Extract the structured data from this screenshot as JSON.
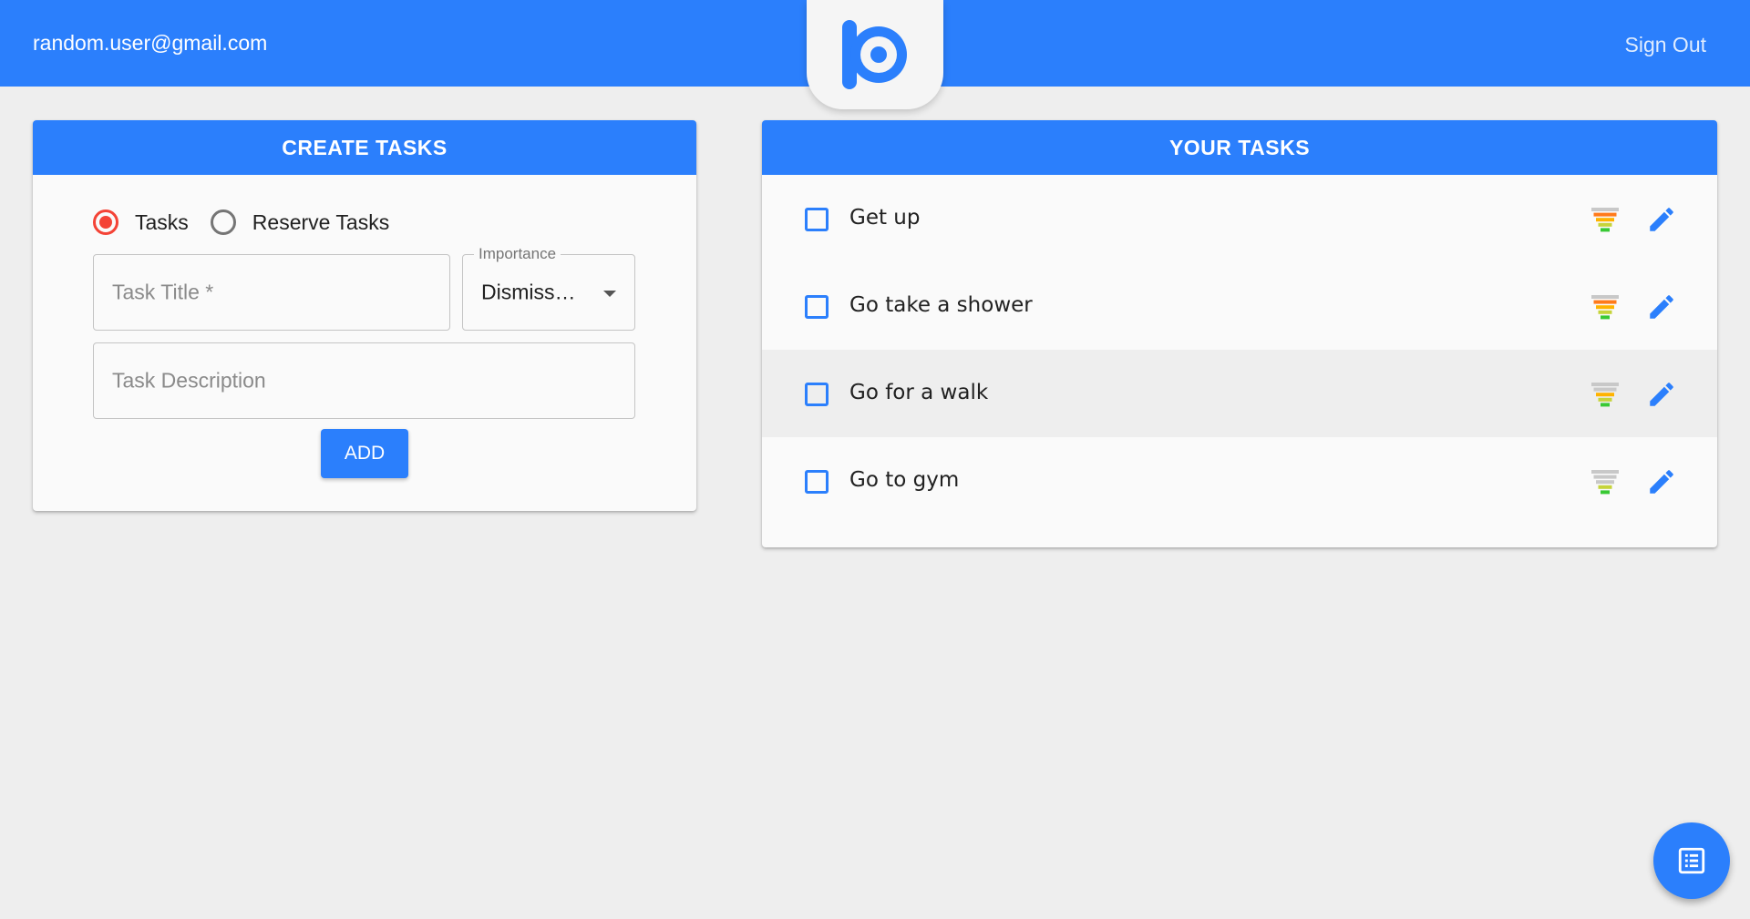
{
  "header": {
    "user_email": "random.user@gmail.com",
    "sign_out_label": "Sign Out",
    "logo_icon": "app-logo-icon"
  },
  "create": {
    "title": "CREATE TASKS",
    "radios": [
      {
        "label": "Tasks",
        "checked": true
      },
      {
        "label": "Reserve Tasks",
        "checked": false
      }
    ],
    "title_placeholder": "Task Title *",
    "importance_label": "Importance",
    "importance_value": "Dismiss…",
    "description_placeholder": "Task Description",
    "add_label": "ADD"
  },
  "tasks": {
    "title": "YOUR TASKS",
    "items": [
      {
        "title": "Get up",
        "level": 4,
        "checked": false
      },
      {
        "title": "Go take a shower",
        "level": 4,
        "checked": false
      },
      {
        "title": "Go for a walk",
        "level": 3,
        "checked": false
      },
      {
        "title": "Go to gym",
        "level": 2,
        "checked": false
      }
    ],
    "priority_colors": [
      "#e0e0e0",
      "#ff7a1a",
      "#ffb300",
      "#c6d43a",
      "#38c934"
    ]
  },
  "fab": {
    "icon": "list-icon"
  },
  "colors": {
    "primary": "#2b7ffc",
    "radio_checked": "#f44336",
    "background": "#eeeeee"
  }
}
